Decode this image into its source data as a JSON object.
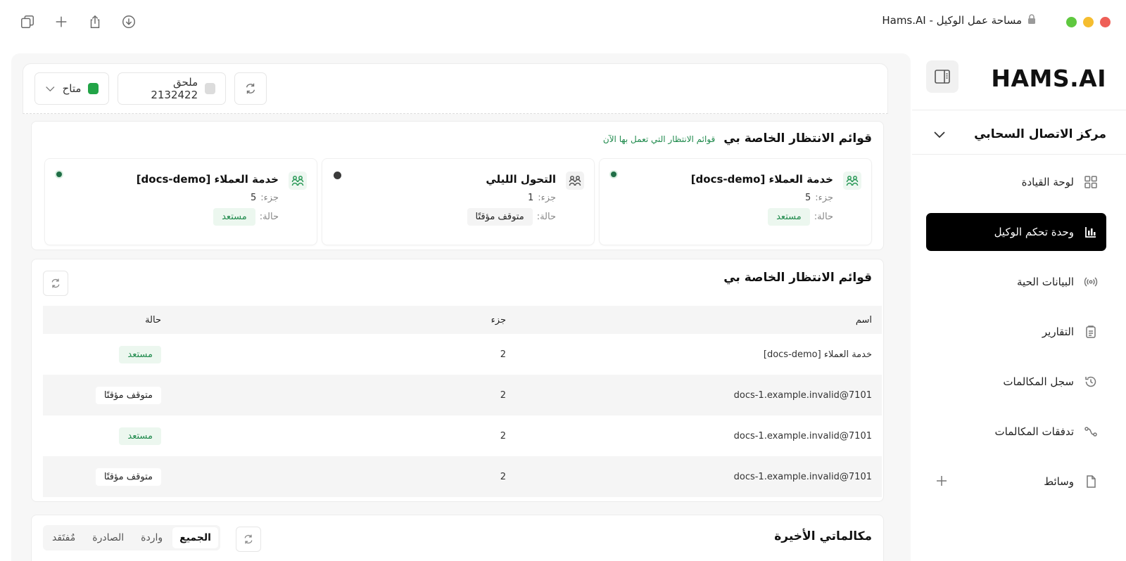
{
  "window": {
    "title": "مساحة عمل الوكيل - Hams.AI",
    "traffic_colors": [
      "#ee5f57",
      "#f5bd2f",
      "#5fc83f"
    ]
  },
  "toolbar_icons": [
    "copy-icon",
    "plus-icon",
    "share-icon",
    "download-icon"
  ],
  "sidebar": {
    "logo": "HAMS.AI",
    "org": "مركز الاتصال السحابي",
    "items": [
      {
        "label": "لوحة القيادة",
        "icon": "grid-icon"
      },
      {
        "label": "وحدة تحكم الوكيل",
        "icon": "bar-chart-icon",
        "active": true
      },
      {
        "label": "البيانات الحية",
        "icon": "broadcast-icon"
      },
      {
        "label": "التقارير",
        "icon": "report-icon"
      },
      {
        "label": "سجل المكالمات",
        "icon": "history-icon"
      },
      {
        "label": "تدفقات المكالمات",
        "icon": "flow-icon"
      },
      {
        "label": "وسائط",
        "icon": "file-icon"
      }
    ]
  },
  "agent_bar": {
    "status_label": "متاح",
    "status_color": "#22a447",
    "extension_label": "ملحق 2132422"
  },
  "queues_card": {
    "title": "قوائم الانتظار الخاصة بي",
    "subtitle": "قوائم الانتظار التي تعمل بها الآن",
    "part_label": "جزء:",
    "status_label": "حالة:",
    "queues": [
      {
        "name": "خدمة العملاء [docs-demo]",
        "part": "5",
        "status": "مستعد"
      },
      {
        "name": "التحول الليلي",
        "part": "1",
        "status": "متوقف مؤقتًا"
      },
      {
        "name": "خدمة العملاء [docs-demo]",
        "part": "5",
        "status": "مستعد"
      }
    ]
  },
  "queues_table": {
    "title": "قوائم الانتظار الخاصة بي",
    "columns": [
      "اسم",
      "جزء",
      "حالة"
    ],
    "rows": [
      {
        "name": "خدمة العملاء [docs-demo]",
        "part": "2",
        "status": "مستعد"
      },
      {
        "name": "7101@docs-1.example.invalid",
        "part": "2",
        "status": "متوقف مؤقتًا"
      },
      {
        "name": "7101@docs-1.example.invalid",
        "part": "2",
        "status": "مستعد"
      },
      {
        "name": "7101@docs-1.example.invalid",
        "part": "2",
        "status": "متوقف مؤقتًا"
      }
    ]
  },
  "recent_calls": {
    "title": "مكالماتي الأخيرة",
    "tabs": [
      "الجميع",
      "واردة",
      "الصادرة",
      "مٌفتَقد"
    ]
  }
}
